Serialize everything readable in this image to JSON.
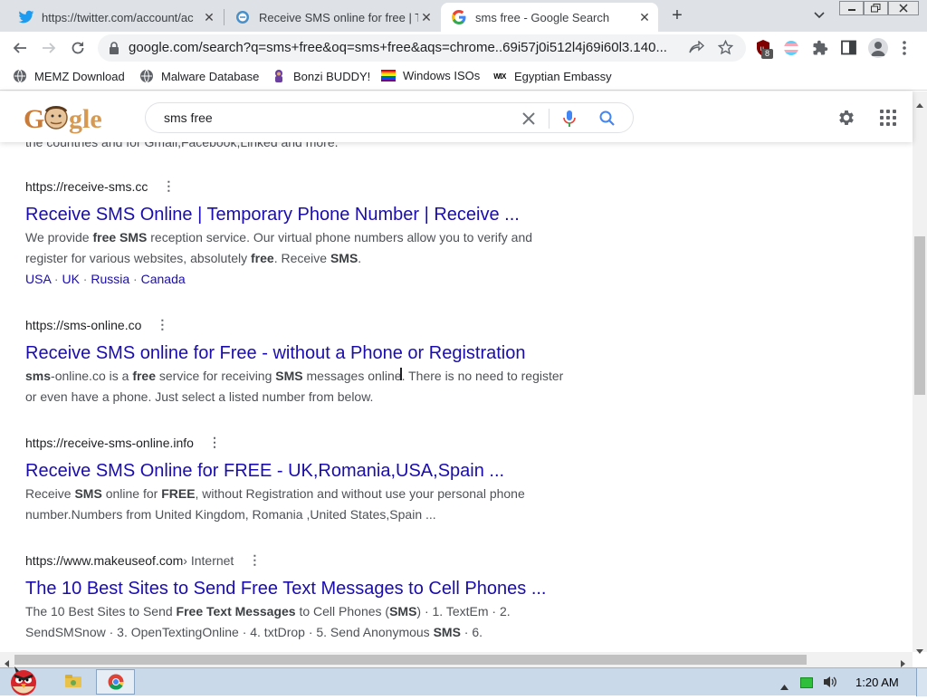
{
  "browser": {
    "tabs": [
      {
        "title": "https://twitter.com/account/ac",
        "icon": "twitter-icon",
        "active": false
      },
      {
        "title": "Receive SMS online for free | T",
        "icon": "sms-site-icon",
        "active": false
      },
      {
        "title": "sms free - Google Search",
        "icon": "google-icon",
        "active": true
      }
    ],
    "new_tab_glyph": "+",
    "address": "google.com/search?q=sms+free&oq=sms+free&aqs=chrome..69i57j0i512l4j69i60l3.140...",
    "extension_badge": "8",
    "bookmarks": [
      {
        "label": "MEMZ Download",
        "icon": "globe-icon"
      },
      {
        "label": "Malware Database",
        "icon": "globe-icon"
      },
      {
        "label": "Bonzi BUDDY!",
        "icon": "bonzi-icon"
      },
      {
        "label": "Windows ISOs",
        "icon": "rainbow-flag-icon"
      },
      {
        "label": "Egyptian Embassy",
        "icon": "wix-icon"
      }
    ],
    "bookmark_wix_text": "WIX"
  },
  "google": {
    "logo_text": "Google",
    "query": "sms free"
  },
  "results": {
    "cut_snippet": "the countries and for Gmail,Facebook,Linked and more.",
    "items": [
      {
        "cite": "https://receive-sms.cc",
        "breadcrumb": "",
        "title": "Receive SMS Online | Temporary Phone Number | Receive ...",
        "snippet": [
          {
            "t": "We provide "
          },
          {
            "b": "free SMS"
          },
          {
            "t": " reception service. Our virtual phone numbers allow you to verify and register for various websites, absolutely "
          },
          {
            "b": "free"
          },
          {
            "t": ". Receive "
          },
          {
            "b": "SMS"
          },
          {
            "t": "."
          }
        ],
        "sitelinks": [
          "USA",
          "UK",
          "Russia",
          "Canada"
        ]
      },
      {
        "cite": "https://sms-online.co",
        "breadcrumb": "",
        "title": "Receive SMS online for Free - without a Phone or Registration",
        "snippet": [
          {
            "b": "sms"
          },
          {
            "t": "-online.co is a "
          },
          {
            "b": "free"
          },
          {
            "t": " service for receiving "
          },
          {
            "b": "SMS"
          },
          {
            "t": " messages online. There is no need to register or even have a phone. Just select a listed number from below."
          }
        ],
        "sitelinks": []
      },
      {
        "cite": "https://receive-sms-online.info",
        "breadcrumb": "",
        "title": "Receive SMS Online for FREE - UK,Romania,USA,Spain ...",
        "snippet": [
          {
            "t": "Receive "
          },
          {
            "b": "SMS"
          },
          {
            "t": " online for "
          },
          {
            "b": "FREE"
          },
          {
            "t": ", without Registration and without use your personal phone number.Numbers from United Kingdom, Romania ,United States,Spain ..."
          }
        ],
        "sitelinks": []
      },
      {
        "cite": "https://www.makeuseof.com",
        "breadcrumb": " › Internet",
        "title": "The 10 Best Sites to Send Free Text Messages to Cell Phones ...",
        "snippet": [
          {
            "t": "The 10 Best Sites to Send "
          },
          {
            "b": "Free Text Messages"
          },
          {
            "t": " to Cell Phones ("
          },
          {
            "b": "SMS"
          },
          {
            "t": ") · 1. TextEm · 2. SendSMSnow · 3. OpenTextingOnline · 4. txtDrop · 5. Send Anonymous "
          },
          {
            "b": "SMS"
          },
          {
            "t": " · 6."
          }
        ],
        "sitelinks": []
      }
    ]
  },
  "taskbar": {
    "clock": "1:20 AM"
  },
  "colors": {
    "link": "#1a0dab",
    "tabstrip": "#dee1e6",
    "taskbar": "#c9d9ea"
  }
}
